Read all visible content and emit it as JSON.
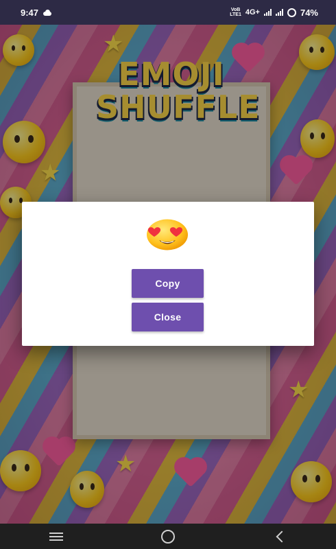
{
  "status_bar": {
    "time": "9:47",
    "volte_top": "VoB",
    "volte_bottom": "LTE1",
    "network": "4G+",
    "battery": "74%"
  },
  "background": {
    "game_title_line1": "EMOJI",
    "game_title_line2": "SHUFFLE"
  },
  "dialog": {
    "emoji": "heart-eyes-emoji",
    "copy_label": "Copy",
    "close_label": "Close"
  },
  "nav_bar": {
    "icons": [
      "menu-icon",
      "home-icon",
      "back-icon"
    ]
  },
  "colors": {
    "button": "#6e4fae",
    "status_bar": "#2d2a45",
    "nav_bar": "#1f1f1f",
    "dialog": "#ffffff"
  }
}
